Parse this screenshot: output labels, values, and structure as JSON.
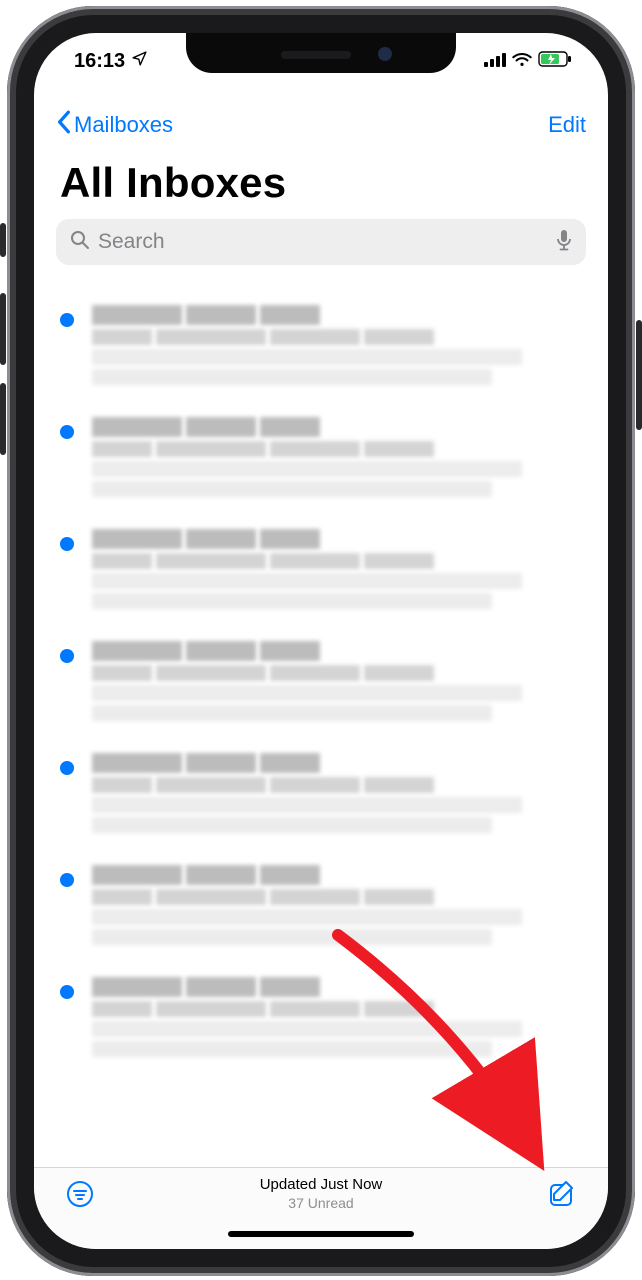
{
  "status": {
    "time": "16:13"
  },
  "nav": {
    "back_label": "Mailboxes",
    "edit_label": "Edit"
  },
  "header": {
    "title": "All Inboxes"
  },
  "search": {
    "placeholder": "Search"
  },
  "toolbar": {
    "status": "Updated Just Now",
    "unread": "37 Unread"
  },
  "colors": {
    "accent": "#0079ff",
    "battery": "#34c759"
  },
  "mail_items": [
    {
      "unread": true
    },
    {
      "unread": true
    },
    {
      "unread": true
    },
    {
      "unread": true
    },
    {
      "unread": true
    },
    {
      "unread": true
    },
    {
      "unread": true
    }
  ]
}
